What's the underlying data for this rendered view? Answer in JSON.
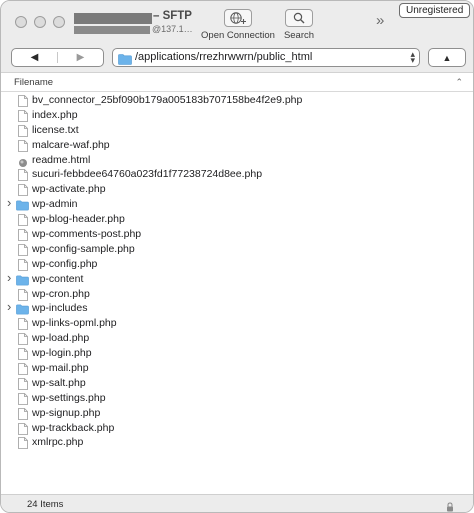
{
  "window": {
    "title_suffix": "– SFTP",
    "subtitle_suffix": "@137.1…"
  },
  "toolbar": {
    "open_connection_label": "Open Connection",
    "search_label": "Search",
    "more_glyph": "»",
    "unregistered_label": "Unregistered"
  },
  "nav": {
    "back_glyph": "◀",
    "forward_glyph": "▶",
    "path": "/applications/rrezhrwwrn/public_html",
    "up_glyph": "▲"
  },
  "list": {
    "column_filename": "Filename",
    "sort_glyph": "⌃",
    "items": [
      {
        "name": "bv_connector_25bf090b179a005183b707158be4f2e9.php",
        "kind": "file"
      },
      {
        "name": "index.php",
        "kind": "file"
      },
      {
        "name": "license.txt",
        "kind": "file"
      },
      {
        "name": "malcare-waf.php",
        "kind": "file"
      },
      {
        "name": "readme.html",
        "kind": "html"
      },
      {
        "name": "sucuri-febbdee64760a023fd1f77238724d8ee.php",
        "kind": "file"
      },
      {
        "name": "wp-activate.php",
        "kind": "file"
      },
      {
        "name": "wp-admin",
        "kind": "folder"
      },
      {
        "name": "wp-blog-header.php",
        "kind": "file"
      },
      {
        "name": "wp-comments-post.php",
        "kind": "file"
      },
      {
        "name": "wp-config-sample.php",
        "kind": "file"
      },
      {
        "name": "wp-config.php",
        "kind": "file"
      },
      {
        "name": "wp-content",
        "kind": "folder"
      },
      {
        "name": "wp-cron.php",
        "kind": "file"
      },
      {
        "name": "wp-includes",
        "kind": "folder"
      },
      {
        "name": "wp-links-opml.php",
        "kind": "file"
      },
      {
        "name": "wp-load.php",
        "kind": "file"
      },
      {
        "name": "wp-login.php",
        "kind": "file"
      },
      {
        "name": "wp-mail.php",
        "kind": "file"
      },
      {
        "name": "wp-salt.php",
        "kind": "file"
      },
      {
        "name": "wp-settings.php",
        "kind": "file"
      },
      {
        "name": "wp-signup.php",
        "kind": "file"
      },
      {
        "name": "wp-trackback.php",
        "kind": "file"
      },
      {
        "name": "xmlrpc.php",
        "kind": "file"
      }
    ]
  },
  "status": {
    "item_count": "24 Items"
  },
  "icons": {
    "file": "document-icon",
    "folder": "folder-icon",
    "html": "html-file-icon"
  },
  "colors": {
    "folder_blue": "#6cb3ea",
    "chrome_gray": "#ececec"
  }
}
